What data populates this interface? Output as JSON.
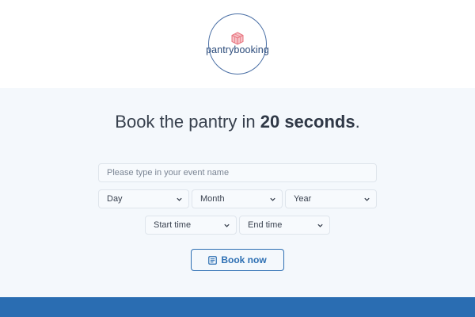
{
  "logo": {
    "text": "pantrybooking",
    "icon": "cube-icon"
  },
  "headline": {
    "prefix": "Book the pantry in ",
    "emphasis": "20 seconds",
    "suffix": "."
  },
  "form": {
    "event_name_placeholder": "Please type in your event name",
    "event_name_value": "",
    "day": "Day",
    "month": "Month",
    "year": "Year",
    "start_time": "Start time",
    "end_time": "End time",
    "submit_label": "Book now",
    "submit_icon": "calendar-list-icon"
  },
  "colors": {
    "brand": "#2a6db2",
    "logo_accent": "#e8737e",
    "background": "#f4f8fc"
  }
}
